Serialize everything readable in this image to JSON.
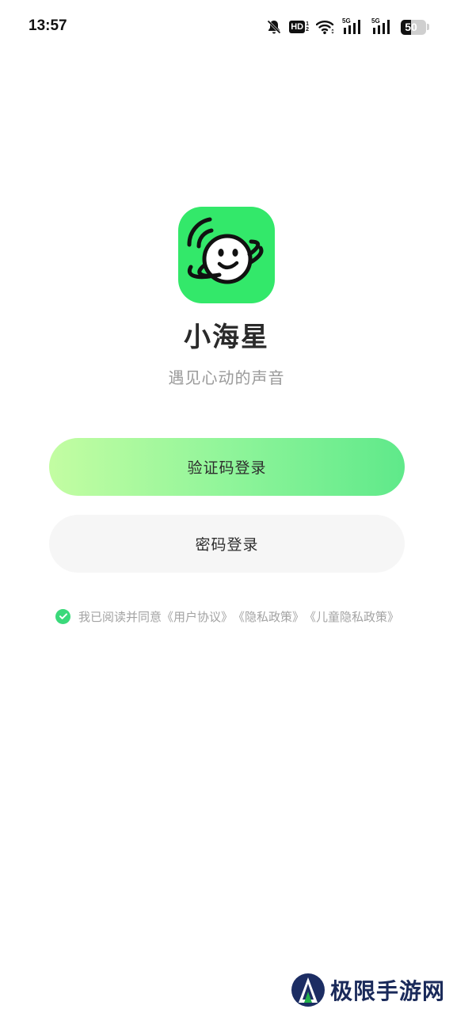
{
  "status_bar": {
    "time": "13:57",
    "hd_label": "HD",
    "hd_sub_top": "1",
    "hd_sub_bottom": "2",
    "signal_1_tag": "5G",
    "signal_2_tag": "5G",
    "battery_level": "50"
  },
  "app": {
    "name": "小海星",
    "slogan": "遇见心动的声音",
    "logo_color": "#33e86a"
  },
  "login": {
    "code_login_label": "验证码登录",
    "password_login_label": "密码登录"
  },
  "agreement": {
    "prefix": "我已阅读并同意",
    "user_agreement": "《用户协议》",
    "privacy_policy": "《隐私政策》",
    "child_privacy_policy": "《儿童隐私政策》",
    "checked": true
  },
  "watermark": {
    "text": "极限手游网"
  },
  "colors": {
    "accent_green": "#33e86a",
    "gradient_start": "#c3fda2",
    "gradient_end": "#5fe98a",
    "check_green": "#3ad97a"
  }
}
